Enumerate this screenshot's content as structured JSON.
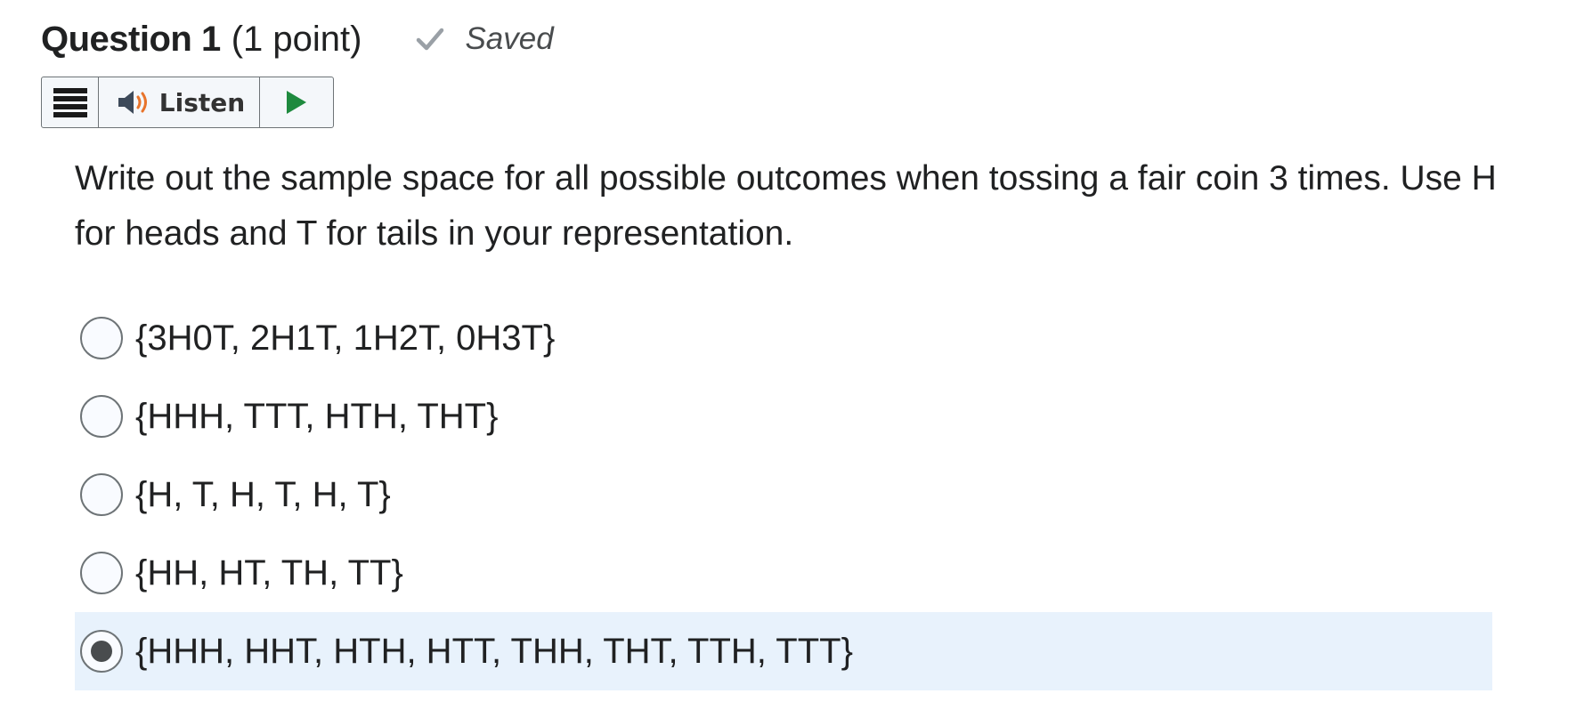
{
  "question": {
    "title": "Question 1",
    "points": "(1 point)",
    "status": "Saved",
    "text": "Write out the sample space for all possible outcomes when tossing a fair coin 3 times. Use H for heads and T for tails in your representation."
  },
  "toolbar": {
    "menu_icon": "hamburger-menu-icon",
    "listen_label": "Listen",
    "speaker_icon": "speaker-icon",
    "play_icon": "play-icon",
    "play_color": "#1e8a3e",
    "speaker_accent": "#e8742b"
  },
  "options": [
    {
      "label": "{3H0T, 2H1T, 1H2T, 0H3T}",
      "selected": false
    },
    {
      "label": "{HHH, TTT, HTH, THT}",
      "selected": false
    },
    {
      "label": "{H, T, H, T, H, T}",
      "selected": false
    },
    {
      "label": "{HH, HT, TH, TT}",
      "selected": false
    },
    {
      "label": "{HHH, HHT, HTH, HTT, THH, THT, TTH, TTT}",
      "selected": true
    }
  ],
  "colors": {
    "selected_bg": "#e8f2fc",
    "check": "#9aa0a6"
  }
}
